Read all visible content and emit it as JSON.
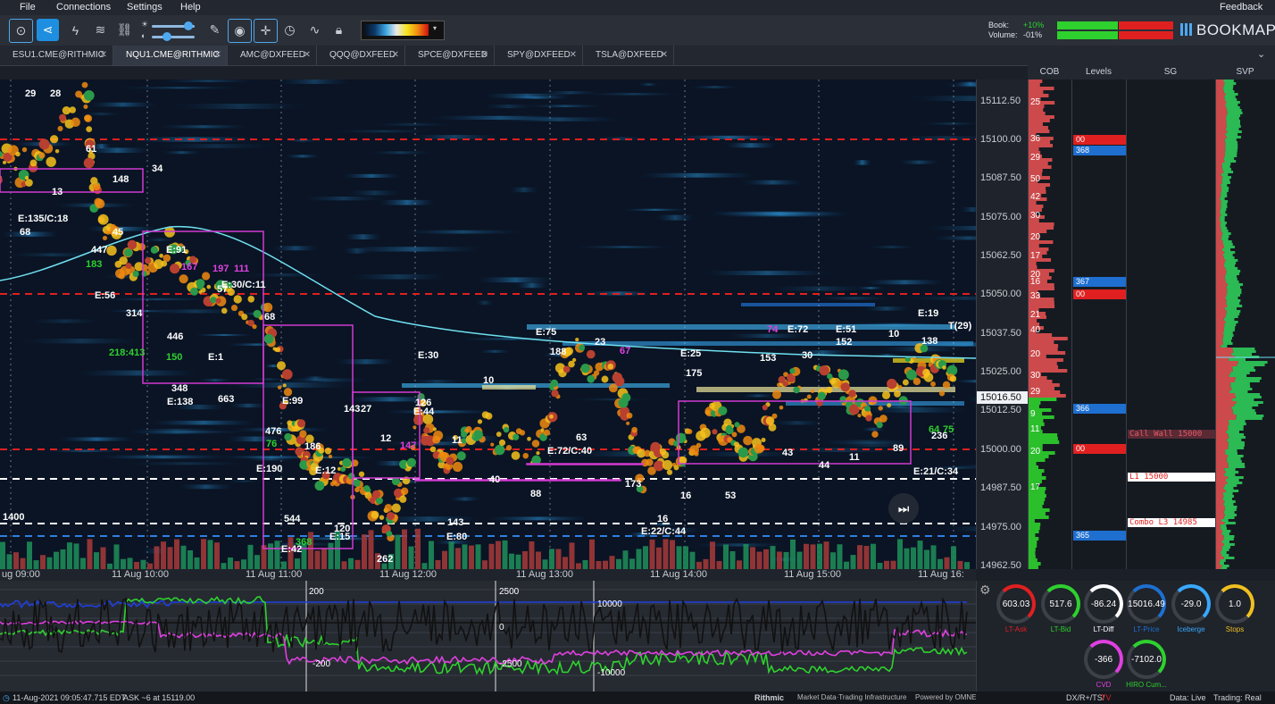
{
  "menu": {
    "file": "File",
    "connections": "Connections",
    "settings": "Settings",
    "help": "Help",
    "feedback": "Feedback"
  },
  "header": {
    "book_label": "Book:",
    "book_value": "+10%",
    "volume_label": "Volume:",
    "volume_value": "-01%",
    "brand": "BOOKMAP"
  },
  "tabs": [
    {
      "label": "ESU1.CME@RITHMIC"
    },
    {
      "label": "NQU1.CME@RITHMIC",
      "active": true
    },
    {
      "label": "AMC@DXFEED"
    },
    {
      "label": "QQQ@DXFEED"
    },
    {
      "label": "SPCE@DXFEED"
    },
    {
      "label": "SPY@DXFEED"
    },
    {
      "label": "TSLA@DXFEED"
    }
  ],
  "columns": {
    "cob": "COB",
    "levels": "Levels",
    "sg": "SG",
    "svp": "SVP"
  },
  "price_axis": [
    "15112.50",
    "15100.00",
    "15087.50",
    "15075.00",
    "15062.50",
    "15050.00",
    "15037.50",
    "15025.00",
    "15012.50",
    "15000.00",
    "14987.50",
    "14975.00",
    "14962.50"
  ],
  "current_price": "15016.50",
  "time_axis": [
    "ug 09:00",
    "11 Aug 10:00",
    "11 Aug 11:00",
    "11 Aug 12:00",
    "11 Aug 13:00",
    "11 Aug 14:00",
    "11 Aug 15:00",
    "11 Aug 16:"
  ],
  "levels": [
    {
      "text": "00",
      "color": "#e02020"
    },
    {
      "text": "368",
      "color": "#1e6fd0"
    },
    {
      "text": "367",
      "color": "#1e6fd0"
    },
    {
      "text": "00",
      "color": "#e02020"
    },
    {
      "text": "366",
      "color": "#1e6fd0"
    },
    {
      "text": "00",
      "color": "#e02020"
    },
    {
      "text": "365",
      "color": "#1e6fd0"
    }
  ],
  "sg_levels": [
    {
      "text": "Call Wall 15000"
    },
    {
      "text": "L1 15000"
    },
    {
      "text": "Combo L3 14985"
    }
  ],
  "cob_numbers": [
    "25",
    "36",
    "29",
    "50",
    "42",
    "30",
    "20",
    "17",
    "20",
    "16",
    "33",
    "21",
    "40",
    "20",
    "30",
    "29",
    "9",
    "11",
    "20",
    "17"
  ],
  "annotations": [
    {
      "t": "E:135/C:18"
    },
    {
      "t": "68"
    },
    {
      "t": "13"
    },
    {
      "t": "61"
    },
    {
      "t": "34"
    },
    {
      "t": "148"
    },
    {
      "t": "447"
    },
    {
      "t": "45"
    },
    {
      "t": "183"
    },
    {
      "t": "E:91"
    },
    {
      "t": "167"
    },
    {
      "t": "197"
    },
    {
      "t": "111"
    },
    {
      "t": "E:56"
    },
    {
      "t": "314"
    },
    {
      "t": "218:413"
    },
    {
      "t": "446"
    },
    {
      "t": "150"
    },
    {
      "t": "E:1"
    },
    {
      "t": "348"
    },
    {
      "t": "E:138"
    },
    {
      "t": "663"
    },
    {
      "t": "E:30/C:11"
    },
    {
      "t": "57"
    },
    {
      "t": "68"
    },
    {
      "t": "E:99"
    },
    {
      "t": "476"
    },
    {
      "t": "76"
    },
    {
      "t": "186"
    },
    {
      "t": "E:190"
    },
    {
      "t": "E:12"
    },
    {
      "t": "143"
    },
    {
      "t": "27"
    },
    {
      "t": "12"
    },
    {
      "t": "147"
    },
    {
      "t": "544"
    },
    {
      "t": "E:42"
    },
    {
      "t": "368"
    },
    {
      "t": "E:15"
    },
    {
      "t": "120"
    },
    {
      "t": "262"
    },
    {
      "t": "60"
    },
    {
      "t": "E:30"
    },
    {
      "t": "126"
    },
    {
      "t": "E:44"
    },
    {
      "t": "11"
    },
    {
      "t": "10"
    },
    {
      "t": "40"
    },
    {
      "t": "88"
    },
    {
      "t": "143"
    },
    {
      "t": "E:80"
    },
    {
      "t": "E:75"
    },
    {
      "t": "188"
    },
    {
      "t": "23"
    },
    {
      "t": "67"
    },
    {
      "t": "63"
    },
    {
      "t": "E:72/C:40"
    },
    {
      "t": "173"
    },
    {
      "t": "16"
    },
    {
      "t": "16"
    },
    {
      "t": "E:22/C:44"
    },
    {
      "t": "E:25"
    },
    {
      "t": "175"
    },
    {
      "t": "53"
    },
    {
      "t": "153"
    },
    {
      "t": "30"
    },
    {
      "t": "74"
    },
    {
      "t": "E:72"
    },
    {
      "t": "E:51"
    },
    {
      "t": "152"
    },
    {
      "t": "10"
    },
    {
      "t": "E:19"
    },
    {
      "t": "138"
    },
    {
      "t": "T(29)"
    },
    {
      "t": "43"
    },
    {
      "t": "44"
    },
    {
      "t": "11"
    },
    {
      "t": "89"
    },
    {
      "t": "236"
    },
    {
      "t": "64"
    },
    {
      "t": "75"
    },
    {
      "t": "E:21/C:34"
    },
    {
      "t": "29"
    },
    {
      "t": "28"
    },
    {
      "t": "1400"
    }
  ],
  "indicator_labels": [
    "200",
    "2500",
    "10000",
    "0",
    "-200",
    "-2500",
    "-10000"
  ],
  "gauges": [
    {
      "value": "603.03",
      "label": "LT-Ask",
      "color": "#e02020"
    },
    {
      "value": "517.6",
      "label": "LT-Bid",
      "color": "#2ed12e"
    },
    {
      "value": "-86.24",
      "label": "LT-Diff",
      "color": "#ffffff"
    },
    {
      "value": "15016.49",
      "label": "LT-Price",
      "color": "#1e6fd0"
    },
    {
      "value": "-29.0",
      "label": "Iceberge",
      "color": "#39a8ff"
    },
    {
      "value": "1.0",
      "label": "Stops",
      "color": "#f0c020"
    },
    {
      "value": "-366",
      "label": "CVD",
      "color": "#e040e0"
    },
    {
      "value": "-7102.0",
      "label": "HIRO Cum...",
      "color": "#2ed12e"
    }
  ],
  "status": {
    "datetime": "11-Aug-2021 09:05:47.715 EDT",
    "ask": "ASK ~6 at 15119.00",
    "rithmic": "Rithmic",
    "rithmic_tag": "Market Data·Trading Infrastructure",
    "omne": "Powered by OMNE",
    "feeds": "DX/R+/TS/",
    "feeds_tv": "TV",
    "data": "Data: Live",
    "trading": "Trading: Real"
  },
  "colors": {
    "bg": "#1b1f27",
    "accent": "#1e8fe0",
    "bid": "#2ed12e",
    "ask": "#e02020"
  }
}
